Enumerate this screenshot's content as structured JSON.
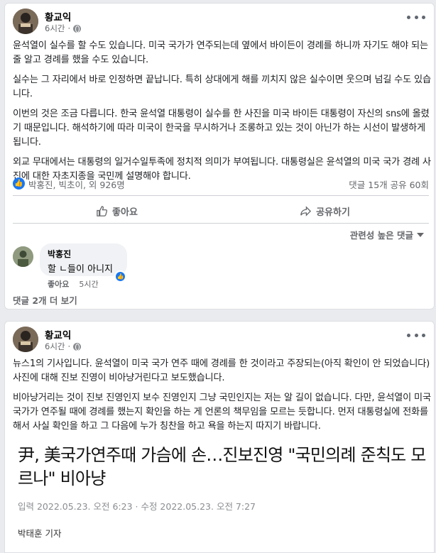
{
  "post1": {
    "author": "황교익",
    "time": "6시간",
    "paragraphs": [
      "윤석열이 실수를 할 수도 있습니다. 미국 국가가 연주되는데 옆에서 바이든이 경례를 하니까 자기도 해야 되는 줄 알고 경례를 했을 수도 있습니다.",
      "실수는 그 자리에서 바로 인정하면 끝납니다. 특히 상대에게 해를 끼치지 않은 실수이면 웃으며 넘길 수도 있습니다.",
      "이번의 것은 조금 다릅니다. 한국 윤석열 대통령이 실수를 한 사진을 미국 바이든 대통령이 자신의 sns에 올렸기 때문입니다. 해석하기에 따라 미국이 한국을 무시하거나 조롱하고 있는 것이 아닌가 하는 시선이 발생하게 됩니다.",
      "외교 무대에서는 대통령의 일거수일투족에 정치적 의미가 부여됩니다. 대통령실은 윤석열의 미국 국가 경례 사진에 대한 자초지종을 국민께 설명해야 합니다."
    ],
    "reactions": "박홍진, 빅초이, 외 926명",
    "counts": "댓글 15개  공유 60회",
    "like_label": "좋아요",
    "share_label": "공유하기",
    "sort_label": "관련성 높은 댓글",
    "comment": {
      "author": "박홍진",
      "text": "할 ㄴ들이 아니지",
      "like_label": "좋아요",
      "time": "5시간"
    },
    "more_comments": "댓글 2개 더 보기"
  },
  "post2": {
    "author": "황교익",
    "time": "6시간",
    "paragraphs": [
      "뉴스1의 기사입니다. 윤석열이 미국 국가 연주 때에 경례를 한 것이라고 주장되는(아직 확인이 안 되었습니다) 사진에 대해 진보 진영이 비아냥거린다고 보도했습니다.",
      "비아냥거리는 것이 진보 진영인지 보수 진영인지 그냥 국민인지는 저는 알 길이 없습니다. 다만, 윤석열이 미국 국가가 연주될 때에 경례를 했는지 확인을 하는 게 언론의 책무임을 모르는 듯합니다. 먼저 대통령실에 전화를 해서 사실 확인을 하고 그 다음에 누가 칭찬을 하고 욕을 하는지 따지기 바랍니다."
    ],
    "news": {
      "headline": "尹, 美국가연주때 가슴에 손…진보진영 \"국민의례 준칙도 모르나\" 비아냥",
      "meta": "입력 2022.05.23. 오전 6:23 · 수정 2022.05.23. 오전 7:27",
      "reporter": "박태훈 기자"
    }
  }
}
